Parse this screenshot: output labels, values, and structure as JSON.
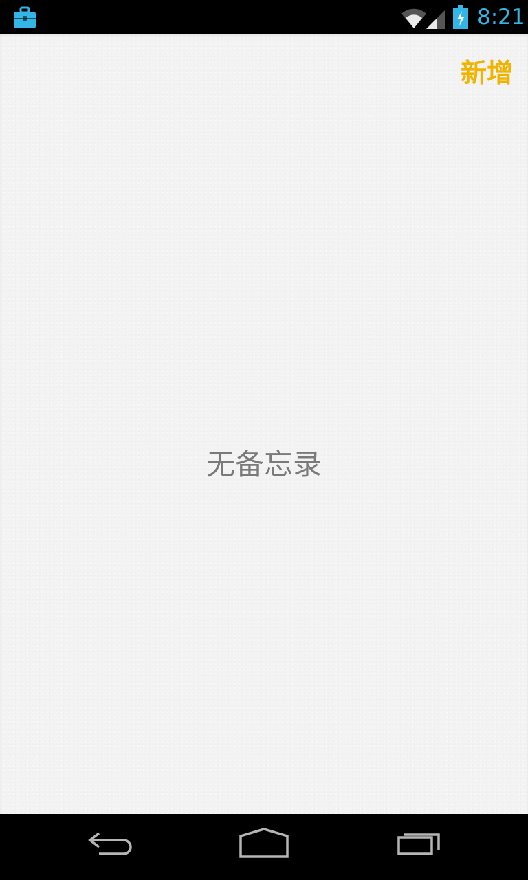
{
  "status_bar": {
    "time": "8:21",
    "icons": {
      "left": "briefcase-icon",
      "wifi": "wifi-icon",
      "signal": "signal-icon",
      "battery": "battery-charging-icon"
    },
    "time_color": "#33b5e5"
  },
  "header": {
    "add_label": "新增",
    "add_color": "#f0b400"
  },
  "main": {
    "empty_message": "无备忘录"
  },
  "nav_bar": {
    "back": "back-icon",
    "home": "home-icon",
    "recents": "recents-icon"
  }
}
